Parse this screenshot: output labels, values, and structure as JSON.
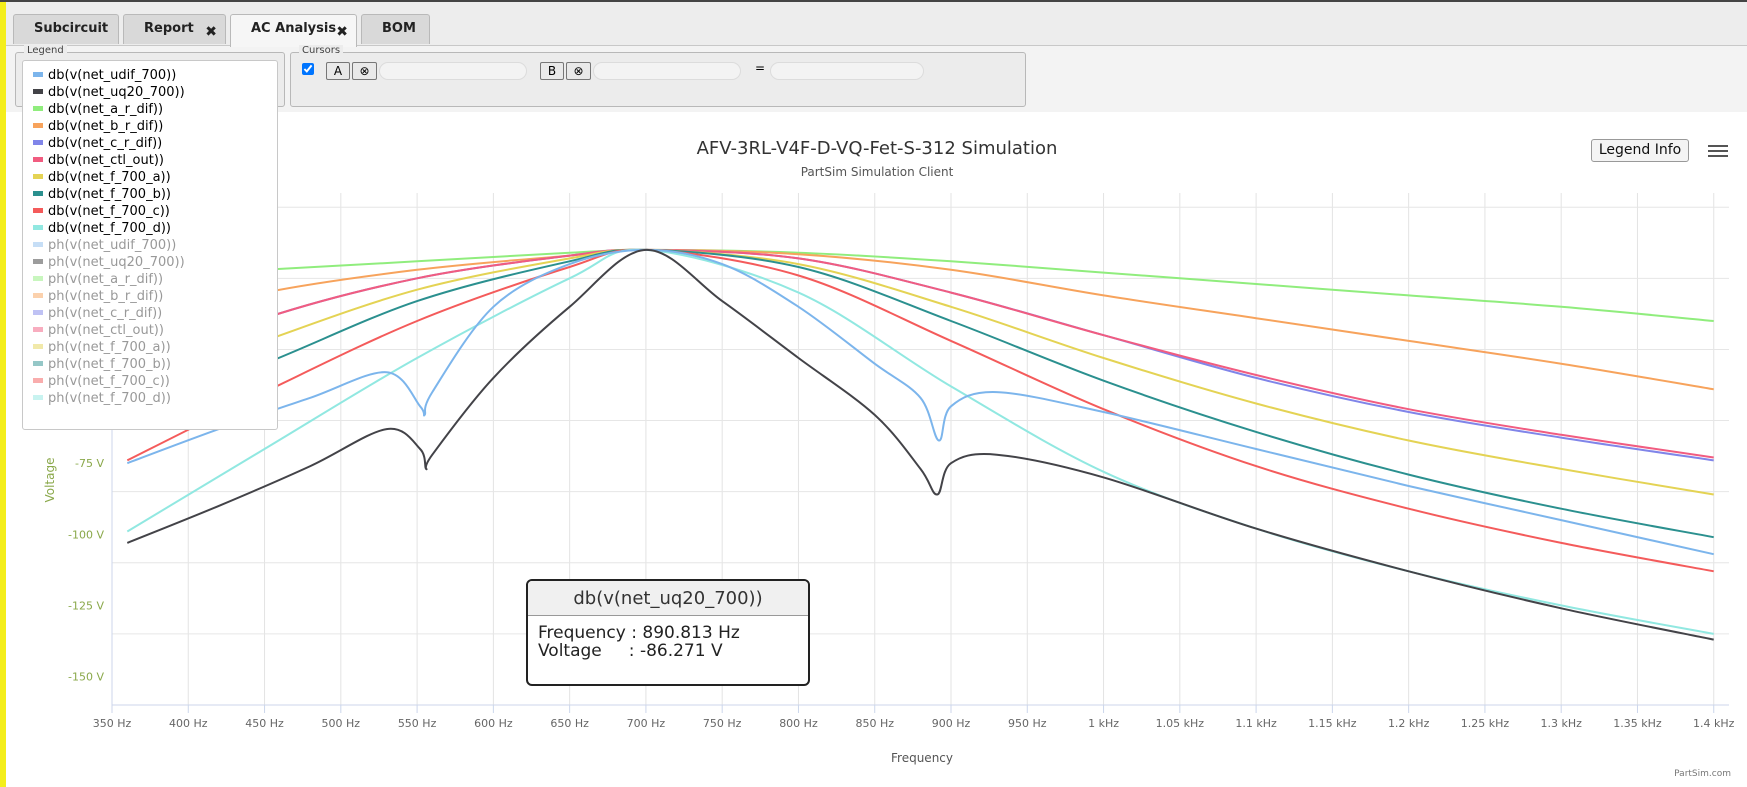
{
  "tabs": [
    {
      "label": "Subcircuit",
      "closable": false,
      "active": false
    },
    {
      "label": "Report",
      "closable": true,
      "active": false
    },
    {
      "label": "AC Analysis",
      "closable": true,
      "active": true
    },
    {
      "label": "BOM",
      "closable": false,
      "active": false
    }
  ],
  "legend_panel": {
    "title": "Legend"
  },
  "cursors_panel": {
    "title": "Cursors",
    "checked": true,
    "a_label": "A",
    "b_label": "B",
    "clear_glyph": "⊗",
    "equals": "="
  },
  "legend_items": [
    {
      "label": "db(v(net_udif_700))",
      "color": "#7cb5ec",
      "dim": false
    },
    {
      "label": "db(v(net_uq20_700))",
      "color": "#434348",
      "dim": false
    },
    {
      "label": "db(v(net_a_r_dif))",
      "color": "#90ed7d",
      "dim": false
    },
    {
      "label": "db(v(net_b_r_dif))",
      "color": "#f7a35c",
      "dim": false
    },
    {
      "label": "db(v(net_c_r_dif))",
      "color": "#8085e9",
      "dim": false
    },
    {
      "label": "db(v(net_ctl_out))",
      "color": "#f15c80",
      "dim": false
    },
    {
      "label": "db(v(net_f_700_a))",
      "color": "#e4d354",
      "dim": false
    },
    {
      "label": "db(v(net_f_700_b))",
      "color": "#2b908f",
      "dim": false
    },
    {
      "label": "db(v(net_f_700_c))",
      "color": "#f45b5b",
      "dim": false
    },
    {
      "label": "db(v(net_f_700_d))",
      "color": "#91e8e1",
      "dim": false
    },
    {
      "label": "ph(v(net_udif_700))",
      "color": "#c6def6",
      "dim": true
    },
    {
      "label": "ph(v(net_uq20_700))",
      "color": "#9c9c9c",
      "dim": true
    },
    {
      "label": "ph(v(net_a_r_dif))",
      "color": "#c8f6be",
      "dim": true
    },
    {
      "label": "ph(v(net_b_r_dif))",
      "color": "#fbd1ad",
      "dim": true
    },
    {
      "label": "ph(v(net_c_r_dif))",
      "color": "#bfc2f4",
      "dim": true
    },
    {
      "label": "ph(v(net_ctl_out))",
      "color": "#f8adbf",
      "dim": true
    },
    {
      "label": "ph(v(net_f_700_a))",
      "color": "#f1e9aa",
      "dim": true
    },
    {
      "label": "ph(v(net_f_700_b))",
      "color": "#95c7c7",
      "dim": true
    },
    {
      "label": "ph(v(net_f_700_c))",
      "color": "#f9adad",
      "dim": true
    },
    {
      "label": "ph(v(net_f_700_d))",
      "color": "#c8f3f0",
      "dim": true
    }
  ],
  "legend_info_label": "Legend Info",
  "menu_icon": "hamburger-icon",
  "tooltip": {
    "title": "db(v(net_uq20_700))",
    "freq_label": "Frequency",
    "freq_value": "890.813 Hz",
    "volt_label": "Voltage",
    "volt_value": "-86.271 V"
  },
  "chart_data": {
    "type": "line",
    "title": "AFV-3RL-V4F-D-VQ-Fet-S-312 Simulation",
    "subtitle": "PartSim Simulation Client",
    "xlabel": "Frequency",
    "ylabel": "Voltage",
    "credits": "PartSim.com",
    "xlim": [
      350,
      1410
    ],
    "ylim": [
      -160,
      20
    ],
    "x_ticks": [
      {
        "v": 350,
        "label": "350 Hz"
      },
      {
        "v": 400,
        "label": "400 Hz"
      },
      {
        "v": 450,
        "label": "450 Hz"
      },
      {
        "v": 500,
        "label": "500 Hz"
      },
      {
        "v": 550,
        "label": "550 Hz"
      },
      {
        "v": 600,
        "label": "600 Hz"
      },
      {
        "v": 650,
        "label": "650 Hz"
      },
      {
        "v": 700,
        "label": "700 Hz"
      },
      {
        "v": 750,
        "label": "750 Hz"
      },
      {
        "v": 800,
        "label": "800 Hz"
      },
      {
        "v": 850,
        "label": "850 Hz"
      },
      {
        "v": 900,
        "label": "900 Hz"
      },
      {
        "v": 950,
        "label": "950 Hz"
      },
      {
        "v": 1000,
        "label": "1 kHz"
      },
      {
        "v": 1050,
        "label": "1.05 kHz"
      },
      {
        "v": 1100,
        "label": "1.1 kHz"
      },
      {
        "v": 1150,
        "label": "1.15 kHz"
      },
      {
        "v": 1200,
        "label": "1.2 kHz"
      },
      {
        "v": 1250,
        "label": "1.25 kHz"
      },
      {
        "v": 1300,
        "label": "1.3 kHz"
      },
      {
        "v": 1350,
        "label": "1.35 kHz"
      },
      {
        "v": 1400,
        "label": "1.4 kHz"
      }
    ],
    "y_ticks": [
      {
        "v": -75,
        "label": "-75 V"
      },
      {
        "v": -100,
        "label": "-100 V"
      },
      {
        "v": -125,
        "label": "-125 V"
      },
      {
        "v": -150,
        "label": "-150 V"
      }
    ],
    "series": [
      {
        "name": "db(v(net_a_r_dif))",
        "color": "#90ed7d",
        "x": [
          360,
          450,
          550,
          650,
          700,
          800,
          900,
          1000,
          1100,
          1200,
          1300,
          1400
        ],
        "y": [
          -9,
          -7,
          -4,
          -1,
          0,
          -1,
          -4,
          -8,
          -12,
          -16,
          -20,
          -25
        ]
      },
      {
        "name": "db(v(net_b_r_dif))",
        "color": "#f7a35c",
        "x": [
          360,
          450,
          550,
          650,
          700,
          800,
          900,
          1000,
          1100,
          1200,
          1300,
          1400
        ],
        "y": [
          -27,
          -15,
          -7,
          -2,
          0,
          -1.5,
          -7,
          -16,
          -24,
          -32,
          -40,
          -49
        ]
      },
      {
        "name": "db(v(net_c_r_dif))",
        "color": "#8085e9",
        "x": [
          360,
          450,
          550,
          650,
          700,
          800,
          900,
          1000,
          1100,
          1200,
          1300,
          1400
        ],
        "y": [
          -43,
          -24,
          -10,
          -2,
          0,
          -3,
          -15,
          -30,
          -45,
          -57,
          -66,
          -74
        ]
      },
      {
        "name": "db(v(net_ctl_out))",
        "color": "#f15c80",
        "x": [
          360,
          450,
          550,
          650,
          700,
          800,
          900,
          1000,
          1100,
          1200,
          1300,
          1400
        ],
        "y": [
          -43,
          -24,
          -10,
          -2,
          0,
          -3,
          -15,
          -30,
          -44,
          -56,
          -65,
          -73
        ]
      },
      {
        "name": "db(v(net_f_700_a))",
        "color": "#e4d354",
        "x": [
          360,
          450,
          550,
          650,
          700,
          800,
          900,
          1000,
          1100,
          1200,
          1300,
          1400
        ],
        "y": [
          -50,
          -32,
          -14,
          -3,
          0,
          -5,
          -20,
          -38,
          -54,
          -67,
          -77,
          -86
        ]
      },
      {
        "name": "db(v(net_f_700_b))",
        "color": "#2b908f",
        "x": [
          360,
          450,
          550,
          650,
          700,
          800,
          900,
          1000,
          1100,
          1200,
          1300,
          1400
        ],
        "y": [
          -58,
          -40,
          -18,
          -4,
          0,
          -6,
          -25,
          -46,
          -64,
          -79,
          -91,
          -101
        ]
      },
      {
        "name": "db(v(net_f_700_c))",
        "color": "#f45b5b",
        "x": [
          360,
          450,
          550,
          650,
          700,
          800,
          900,
          1000,
          1100,
          1200,
          1300,
          1400
        ],
        "y": [
          -74,
          -50,
          -25,
          -6,
          0,
          -9,
          -32,
          -56,
          -76,
          -91,
          -103,
          -113
        ]
      },
      {
        "name": "db(v(net_f_700_d))",
        "color": "#91e8e1",
        "x": [
          360,
          450,
          550,
          650,
          700,
          800,
          900,
          1000,
          1100,
          1200,
          1300,
          1400
        ],
        "y": [
          -99,
          -70,
          -38,
          -10,
          0,
          -15,
          -48,
          -78,
          -98,
          -113,
          -125,
          -135
        ]
      },
      {
        "name": "db(v(net_udif_700))",
        "color": "#7cb5ec",
        "x": [
          360,
          420,
          480,
          530,
          552,
          555,
          560,
          600,
          650,
          700,
          750,
          800,
          850,
          880,
          892,
          900,
          930,
          1000,
          1100,
          1200,
          1300,
          1400
        ],
        "y": [
          -75,
          -63,
          -52,
          -43,
          -55,
          -58,
          -50,
          -20,
          -5,
          0,
          -5,
          -20,
          -40,
          -52,
          -67,
          -55,
          -50,
          -57,
          -70,
          -83,
          -95,
          -107
        ]
      },
      {
        "name": "db(v(net_uq20_700))",
        "color": "#434348",
        "x": [
          360,
          420,
          480,
          530,
          552,
          556,
          560,
          600,
          650,
          700,
          750,
          800,
          850,
          880,
          891,
          900,
          930,
          1000,
          1100,
          1200,
          1300,
          1400
        ],
        "y": [
          -103,
          -90,
          -76,
          -63,
          -70,
          -77,
          -72,
          -45,
          -20,
          0,
          -18,
          -38,
          -58,
          -77,
          -86,
          -75,
          -72,
          -80,
          -98,
          -113,
          -126,
          -137
        ]
      }
    ]
  }
}
